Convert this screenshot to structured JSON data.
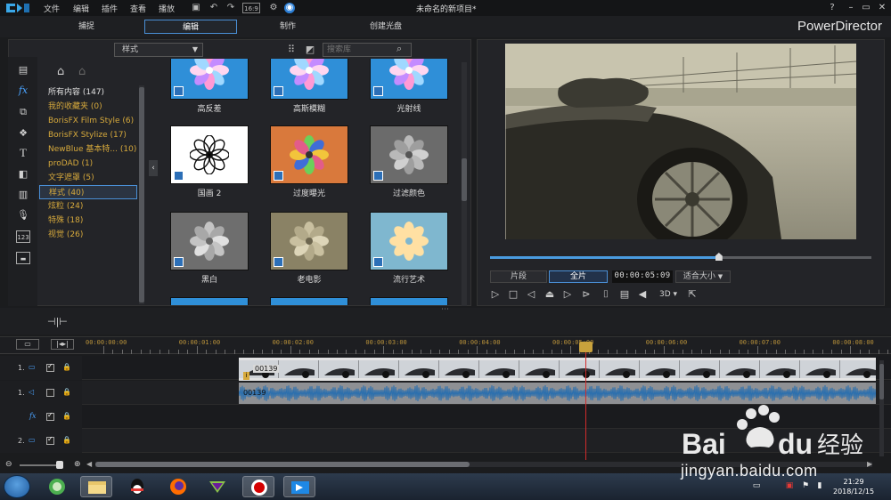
{
  "menu": {
    "items": [
      "文件",
      "编辑",
      "插件",
      "查看",
      "播放"
    ],
    "title": "未命名的新项目*"
  },
  "window": {
    "min": "–",
    "restore": "▭",
    "close": "✕",
    "help": "?"
  },
  "tabs": [
    {
      "label": "捕捉"
    },
    {
      "label": "编辑",
      "active": true
    },
    {
      "label": "制作"
    },
    {
      "label": "创建光盘"
    }
  ],
  "brand": "PowerDirector",
  "library": {
    "dropdown": "样式",
    "search_placeholder": "搜索库",
    "categories": [
      {
        "label": "所有内容 (147)",
        "style": "white"
      },
      {
        "label": "我的收藏夹 (0)"
      },
      {
        "label": "BorisFX Film Style (6)"
      },
      {
        "label": "BorisFX Stylize (17)"
      },
      {
        "label": "NewBlue 基本特... (10)"
      },
      {
        "label": "proDAD (1)"
      },
      {
        "label": "文字遮罩 (5)"
      },
      {
        "label": "样式 (40)",
        "selected": true
      },
      {
        "label": "炫粒 (24)"
      },
      {
        "label": "特殊 (18)"
      },
      {
        "label": "视觉 (26)"
      }
    ],
    "effects": [
      {
        "label": "高反差",
        "bg": "#2f8fd8"
      },
      {
        "label": "高斯模糊",
        "bg": "#2f8fd8"
      },
      {
        "label": "光射线",
        "bg": "#2f8fd8"
      },
      {
        "label": "国画 2",
        "bg": "#ffffff"
      },
      {
        "label": "过度曝光",
        "bg": "#d9793c"
      },
      {
        "label": "过滤颜色",
        "bg": "#6b6b6b"
      },
      {
        "label": "黑白",
        "bg": "#6e6e6e"
      },
      {
        "label": "老电影",
        "bg": "#8a8265"
      },
      {
        "label": "流行艺术",
        "bg": "#7fb7cf"
      }
    ]
  },
  "preview": {
    "clip_btn": "片段",
    "full_btn": "全片",
    "timecode": "00:00:05:09",
    "fit": "适合大小",
    "threed": "3D",
    "progress": 0.6
  },
  "timeline": {
    "ticks": [
      "00:00:00:00",
      "00:00:01:00",
      "00:00:02:00",
      "00:00:03:00",
      "00:00:04:00",
      "00:00:05:00",
      "00:00:06:00",
      "00:00:07:00",
      "00:00:08:00"
    ],
    "tracks": [
      {
        "label": "1.",
        "type": "video",
        "checked": true
      },
      {
        "label": "1.",
        "type": "audio",
        "checked": false
      },
      {
        "label": "fx",
        "type": "fx",
        "checked": true
      },
      {
        "label": "2.",
        "type": "video",
        "checked": true
      }
    ],
    "video_clip": "00139",
    "audio_clip": "00139"
  },
  "taskbar": {
    "time": "21:29",
    "date": "2018/12/15"
  },
  "watermark": {
    "brand": "Bai du 经验",
    "url": "jingyan.baidu.com"
  },
  "colors": {
    "accent": "#4a8fd6",
    "category": "#d6a93c",
    "playhead": "#d12b2b"
  }
}
